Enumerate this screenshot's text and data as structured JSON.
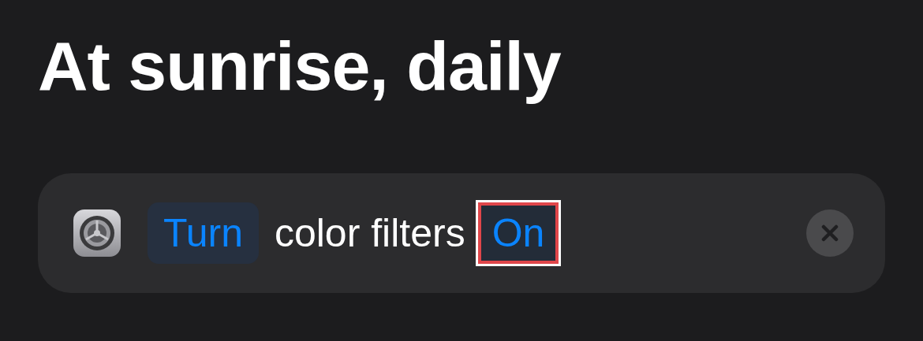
{
  "title": "At sunrise, daily",
  "action": {
    "tokens": [
      {
        "kind": "parameter",
        "text": "Turn",
        "highlighted": false
      },
      {
        "kind": "text",
        "text": "color filters"
      },
      {
        "kind": "parameter",
        "text": "On",
        "highlighted": true
      }
    ]
  }
}
